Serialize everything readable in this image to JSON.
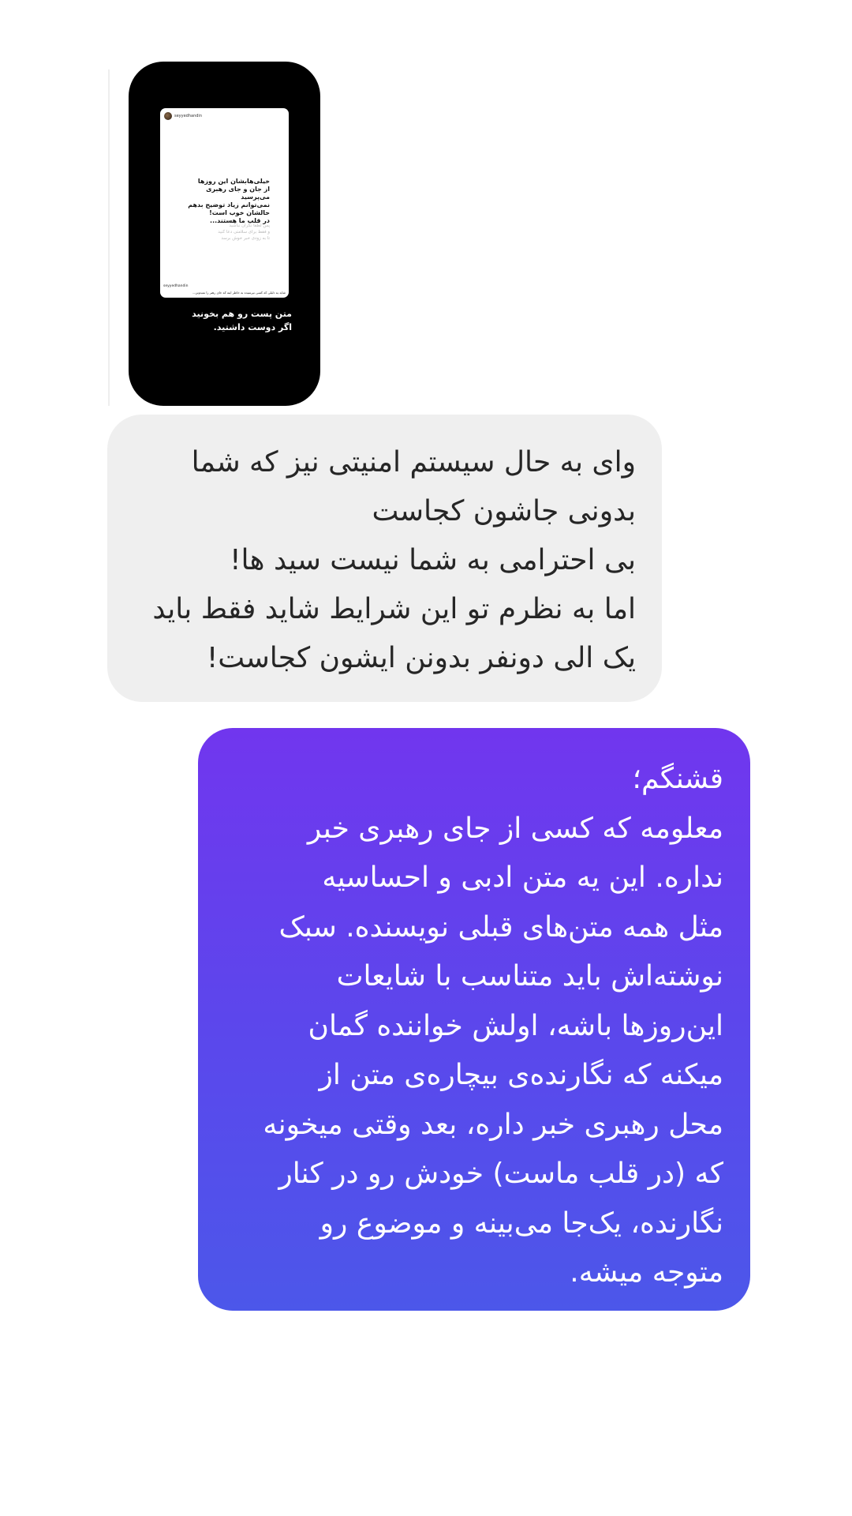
{
  "shared_story": {
    "post_username": "seyyedhandin",
    "post_headline": "خیلی‌هابشان این روزها\nاز جان و جای رهبری می‌پرسید\nنمی‌توانم زیاد توضیح بدهم\nحالشان خوب است!\nدر قلب ما هستند...",
    "post_subtext": "پس لطفا نگران نباشید\nو فقط برای سلامتی دعا کنید\nتا به زودی خبر خوش برسد",
    "post_footer_username": "seyyedhandin",
    "post_caption": "شاید یه دلیلی که کسی نپرسیده به خاطر اینه که جای رهبر را نمیدونن...",
    "story_caption": "متن پست رو هم بخونید\nاگر دوست داشتید."
  },
  "messages": [
    {
      "direction": "received",
      "lines": [
        "وای به حال سیستم امنیتی نیز که شما",
        "بدونی جاشون کجاست",
        "بی احترامی به شما نیست سید ها!",
        "اما به نظرم تو این شرایط شاید فقط باید",
        "یک الی دونفر بدونن ایشون کجاست!"
      ]
    },
    {
      "direction": "sent",
      "lines": [
        "قشنگم؛",
        "معلومه که کسی از جای رهبری خبر",
        "نداره. این یه متن ادبی و احساسیه",
        "مثل همه متن‌های قبلی نویسنده. سبک",
        "نوشته‌اش باید متناسب با شایعات",
        "این‌روزها باشه، اولش خواننده گمان",
        "میکنه که نگارنده‌ی بیچاره‌ی متن از",
        "محل رهبری خبر داره، بعد وقتی میخونه",
        "که (در قلب ماست) خودش رو در کنار",
        "نگارنده، یک‌جا می‌بینه و موضوع رو",
        "متوجه میشه."
      ]
    }
  ]
}
